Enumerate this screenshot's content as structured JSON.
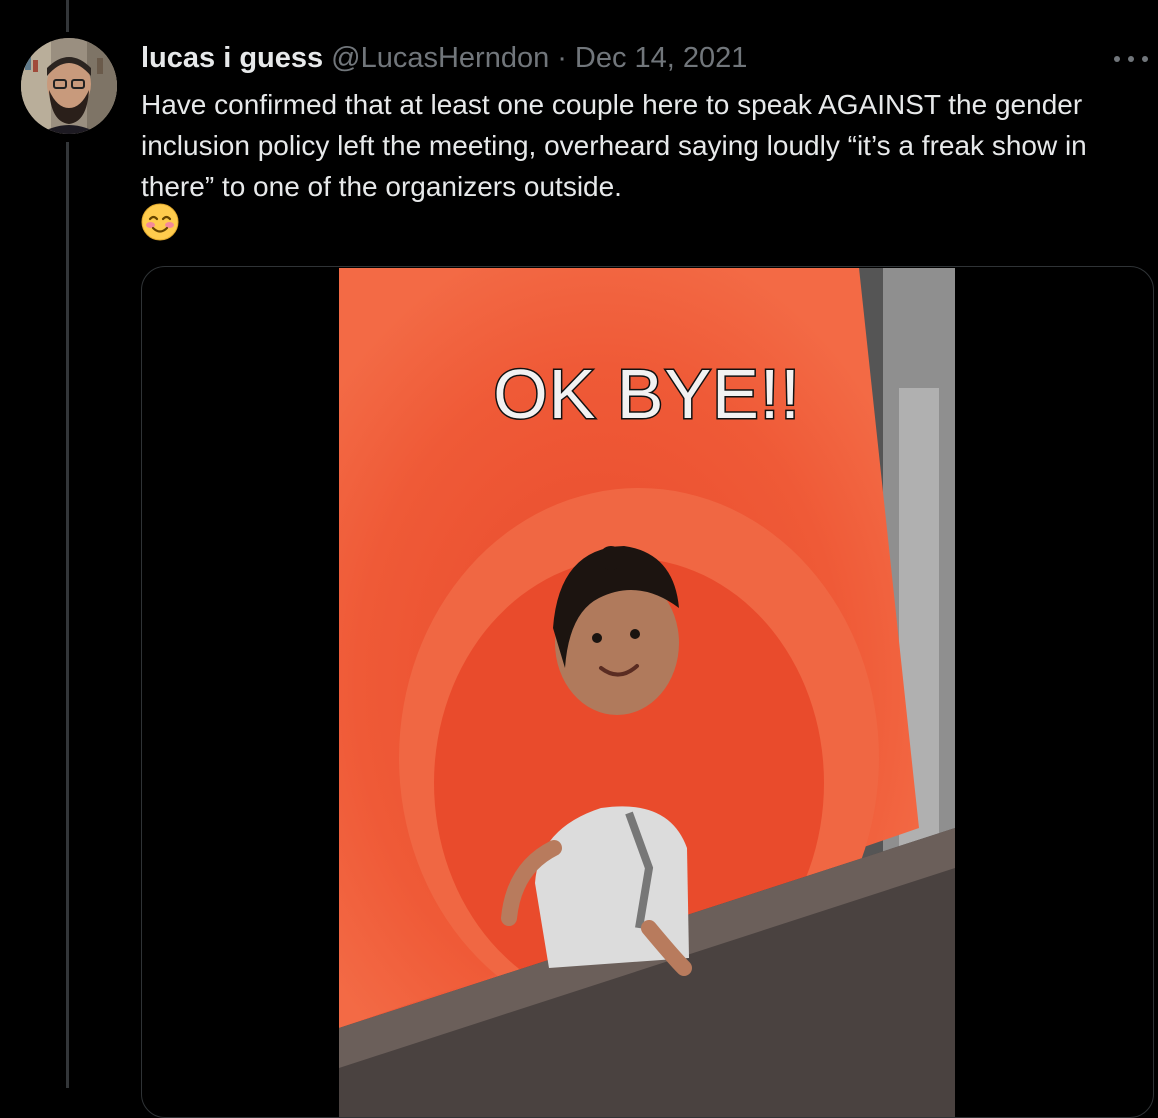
{
  "tweet": {
    "author_name": "lucas i guess",
    "author_handle": "@LucasHerndon",
    "separator": "·",
    "date": "Dec 14, 2021",
    "text": "Have confirmed that at least one couple here to speak AGAINST the gender inclusion policy left the meeting, overheard saying loudly “it’s a freak show in there” to one of the organizers outside.",
    "emoji": "smiling-face-with-smiling-eyes",
    "media": {
      "type": "gif",
      "caption": "OK BYE!!"
    }
  },
  "colors": {
    "background": "#000000",
    "primary_text": "#e7e9ea",
    "secondary_text": "#71767b",
    "border": "#2f3336",
    "gif_slide": "#ef5a37"
  }
}
